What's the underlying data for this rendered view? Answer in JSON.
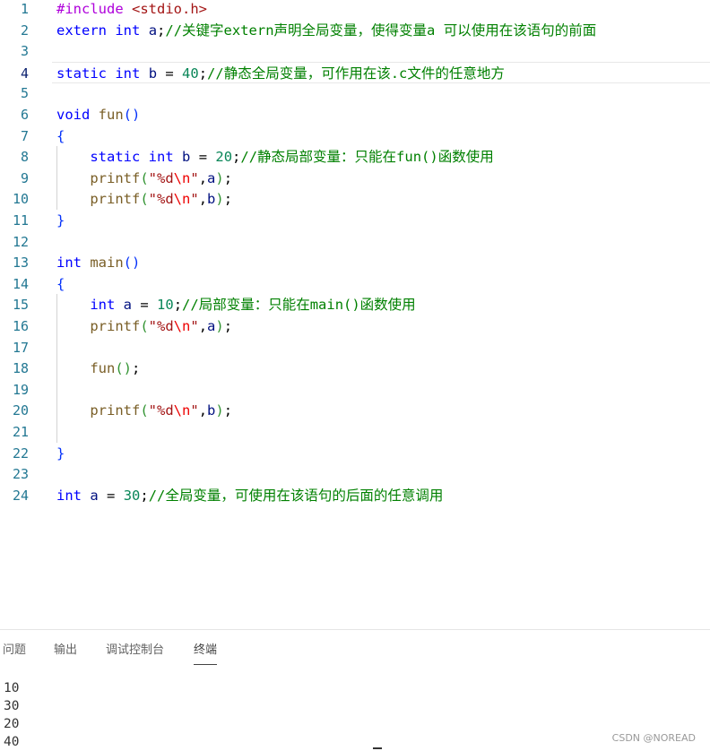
{
  "editor": {
    "lines": [
      {
        "n": "1",
        "tokens": [
          {
            "c": "pp",
            "t": "#include "
          },
          {
            "c": "str",
            "t": "<stdio.h>"
          }
        ]
      },
      {
        "n": "2",
        "tokens": [
          {
            "c": "kw",
            "t": "extern"
          },
          {
            "c": "plain",
            "t": " "
          },
          {
            "c": "kw",
            "t": "int"
          },
          {
            "c": "plain",
            "t": " "
          },
          {
            "c": "var",
            "t": "a"
          },
          {
            "c": "plain",
            "t": ";"
          },
          {
            "c": "cm",
            "t": "//关键字extern声明全局变量，使得变量a 可以使用在该语句的前面"
          }
        ]
      },
      {
        "n": "3",
        "tokens": []
      },
      {
        "n": "4",
        "tokens": [
          {
            "c": "kw",
            "t": "static"
          },
          {
            "c": "plain",
            "t": " "
          },
          {
            "c": "kw",
            "t": "int"
          },
          {
            "c": "plain",
            "t": " "
          },
          {
            "c": "var",
            "t": "b"
          },
          {
            "c": "plain",
            "t": " = "
          },
          {
            "c": "num",
            "t": "40"
          },
          {
            "c": "plain",
            "t": ";"
          },
          {
            "c": "cm",
            "t": "//静态全局变量，可作用在该.c文件的任意地方"
          }
        ]
      },
      {
        "n": "5",
        "tokens": []
      },
      {
        "n": "6",
        "tokens": [
          {
            "c": "kw",
            "t": "void"
          },
          {
            "c": "plain",
            "t": " "
          },
          {
            "c": "fn",
            "t": "fun"
          },
          {
            "c": "br1",
            "t": "()"
          }
        ]
      },
      {
        "n": "7",
        "tokens": [
          {
            "c": "br1",
            "t": "{"
          }
        ]
      },
      {
        "n": "8",
        "tokens": [
          {
            "c": "plain",
            "t": "    "
          },
          {
            "c": "kw",
            "t": "static"
          },
          {
            "c": "plain",
            "t": " "
          },
          {
            "c": "kw",
            "t": "int"
          },
          {
            "c": "plain",
            "t": " "
          },
          {
            "c": "var",
            "t": "b"
          },
          {
            "c": "plain",
            "t": " = "
          },
          {
            "c": "num",
            "t": "20"
          },
          {
            "c": "plain",
            "t": ";"
          },
          {
            "c": "cm",
            "t": "//静态局部变量：只能在fun()函数使用"
          }
        ]
      },
      {
        "n": "9",
        "tokens": [
          {
            "c": "plain",
            "t": "    "
          },
          {
            "c": "fn",
            "t": "printf"
          },
          {
            "c": "br2",
            "t": "("
          },
          {
            "c": "str",
            "t": "\"%d"
          },
          {
            "c": "esc",
            "t": "\\n"
          },
          {
            "c": "str",
            "t": "\""
          },
          {
            "c": "plain",
            "t": ","
          },
          {
            "c": "var",
            "t": "a"
          },
          {
            "c": "br2",
            "t": ")"
          },
          {
            "c": "plain",
            "t": ";"
          }
        ]
      },
      {
        "n": "10",
        "tokens": [
          {
            "c": "plain",
            "t": "    "
          },
          {
            "c": "fn",
            "t": "printf"
          },
          {
            "c": "br2",
            "t": "("
          },
          {
            "c": "str",
            "t": "\"%d"
          },
          {
            "c": "esc",
            "t": "\\n"
          },
          {
            "c": "str",
            "t": "\""
          },
          {
            "c": "plain",
            "t": ","
          },
          {
            "c": "var",
            "t": "b"
          },
          {
            "c": "br2",
            "t": ")"
          },
          {
            "c": "plain",
            "t": ";"
          }
        ]
      },
      {
        "n": "11",
        "tokens": [
          {
            "c": "br1",
            "t": "}"
          }
        ]
      },
      {
        "n": "12",
        "tokens": []
      },
      {
        "n": "13",
        "tokens": [
          {
            "c": "kw",
            "t": "int"
          },
          {
            "c": "plain",
            "t": " "
          },
          {
            "c": "fn",
            "t": "main"
          },
          {
            "c": "br1",
            "t": "()"
          }
        ]
      },
      {
        "n": "14",
        "tokens": [
          {
            "c": "br1",
            "t": "{"
          }
        ]
      },
      {
        "n": "15",
        "tokens": [
          {
            "c": "plain",
            "t": "    "
          },
          {
            "c": "kw",
            "t": "int"
          },
          {
            "c": "plain",
            "t": " "
          },
          {
            "c": "var",
            "t": "a"
          },
          {
            "c": "plain",
            "t": " = "
          },
          {
            "c": "num",
            "t": "10"
          },
          {
            "c": "plain",
            "t": ";"
          },
          {
            "c": "cm",
            "t": "//局部变量：只能在main()函数使用"
          }
        ]
      },
      {
        "n": "16",
        "tokens": [
          {
            "c": "plain",
            "t": "    "
          },
          {
            "c": "fn",
            "t": "printf"
          },
          {
            "c": "br2",
            "t": "("
          },
          {
            "c": "str",
            "t": "\"%d"
          },
          {
            "c": "esc",
            "t": "\\n"
          },
          {
            "c": "str",
            "t": "\""
          },
          {
            "c": "plain",
            "t": ","
          },
          {
            "c": "var",
            "t": "a"
          },
          {
            "c": "br2",
            "t": ")"
          },
          {
            "c": "plain",
            "t": ";"
          }
        ]
      },
      {
        "n": "17",
        "tokens": []
      },
      {
        "n": "18",
        "tokens": [
          {
            "c": "plain",
            "t": "    "
          },
          {
            "c": "fn",
            "t": "fun"
          },
          {
            "c": "br2",
            "t": "()"
          },
          {
            "c": "plain",
            "t": ";"
          }
        ]
      },
      {
        "n": "19",
        "tokens": []
      },
      {
        "n": "20",
        "tokens": [
          {
            "c": "plain",
            "t": "    "
          },
          {
            "c": "fn",
            "t": "printf"
          },
          {
            "c": "br2",
            "t": "("
          },
          {
            "c": "str",
            "t": "\"%d"
          },
          {
            "c": "esc",
            "t": "\\n"
          },
          {
            "c": "str",
            "t": "\""
          },
          {
            "c": "plain",
            "t": ","
          },
          {
            "c": "var",
            "t": "b"
          },
          {
            "c": "br2",
            "t": ")"
          },
          {
            "c": "plain",
            "t": ";"
          }
        ]
      },
      {
        "n": "21",
        "tokens": []
      },
      {
        "n": "22",
        "tokens": [
          {
            "c": "br1",
            "t": "}"
          }
        ]
      },
      {
        "n": "23",
        "tokens": []
      },
      {
        "n": "24",
        "tokens": [
          {
            "c": "kw",
            "t": "int"
          },
          {
            "c": "plain",
            "t": " "
          },
          {
            "c": "var",
            "t": "a"
          },
          {
            "c": "plain",
            "t": " = "
          },
          {
            "c": "num",
            "t": "30"
          },
          {
            "c": "plain",
            "t": ";"
          },
          {
            "c": "cm",
            "t": "//全局变量，可使用在该语句的后面的任意调用"
          }
        ]
      }
    ],
    "current_line": "4"
  },
  "panel": {
    "tabs": [
      {
        "label": "问题",
        "active": false
      },
      {
        "label": "输出",
        "active": false
      },
      {
        "label": "调试控制台",
        "active": false
      },
      {
        "label": "终端",
        "active": true
      }
    ],
    "terminal_output": [
      "10",
      "30",
      "20",
      "40"
    ]
  },
  "watermark": "CSDN @NOREAD"
}
